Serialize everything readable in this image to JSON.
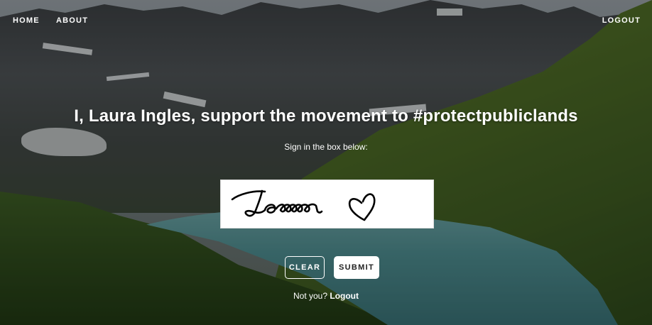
{
  "nav": {
    "home": "HOME",
    "about": "ABOUT",
    "logout": "LOGOUT"
  },
  "main": {
    "headline": "I, Laura Ingles, support the movement to #protectpubliclands",
    "instruction": "Sign in the box below:",
    "signature": "Laura ♡"
  },
  "buttons": {
    "clear": "CLEAR",
    "submit": "SUBMIT"
  },
  "footer": {
    "not_you": "Not you?",
    "logout_link": "Logout"
  },
  "colors": {
    "overlay": "rgba(0,0,0,0.30)",
    "button_submit_bg": "#ffffff",
    "signature_ink": "#000000"
  }
}
